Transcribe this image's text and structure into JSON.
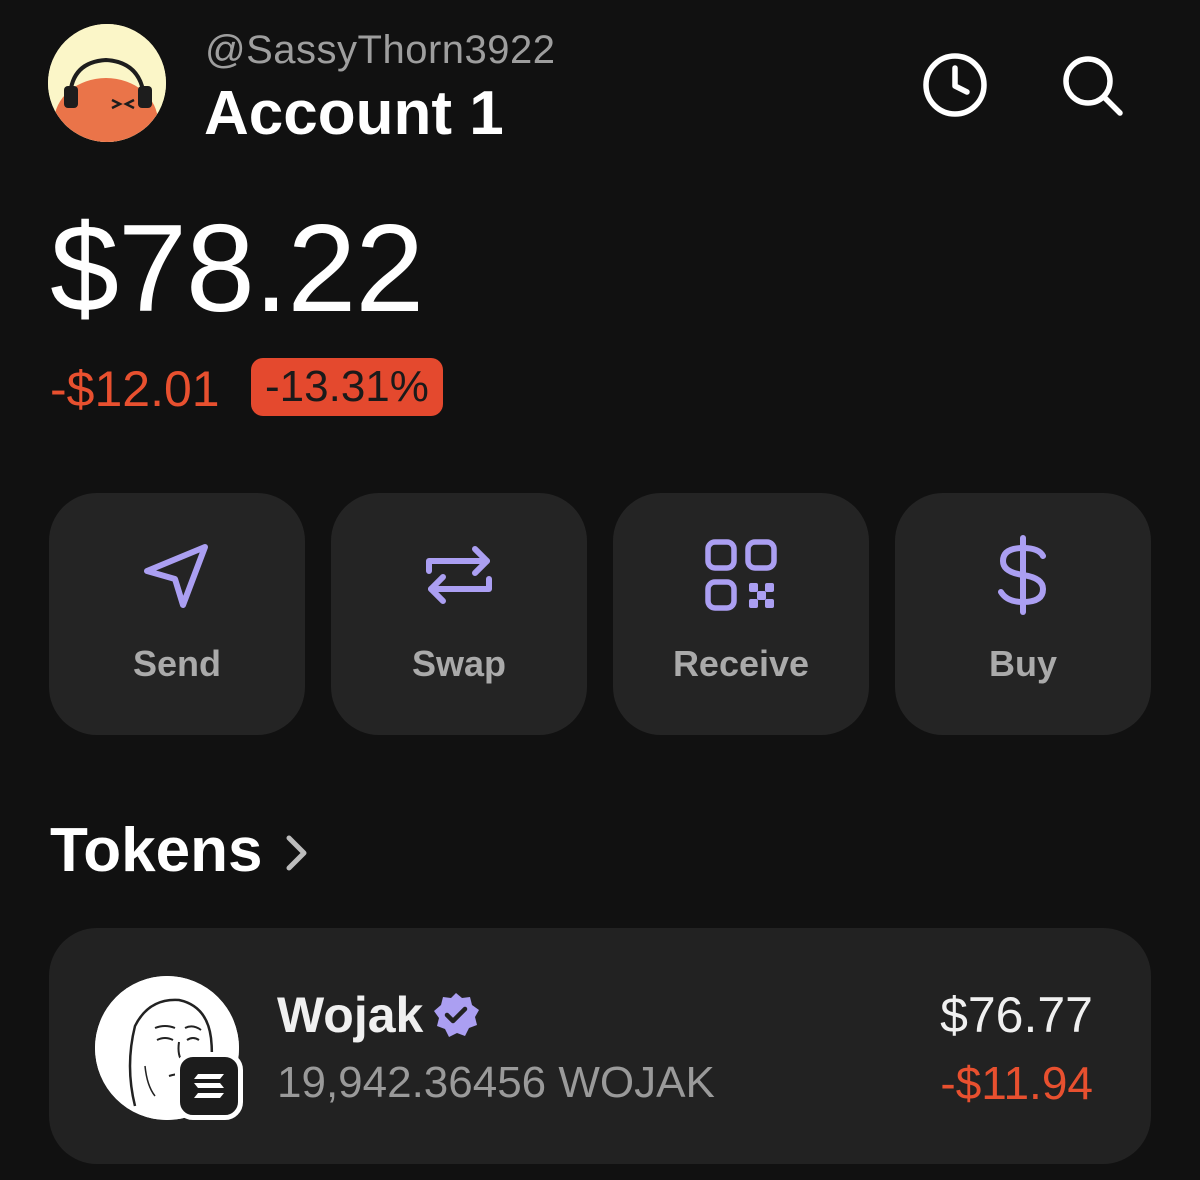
{
  "header": {
    "handle": "@SassyThorn3922",
    "account_name": "Account 1",
    "icons": [
      "avatar",
      "history-icon",
      "search-icon"
    ]
  },
  "balance": {
    "total": "$78.22",
    "change_amount": "-$12.01",
    "change_percent": "-13.31%"
  },
  "actions": [
    {
      "label": "Send",
      "icon": "send-icon"
    },
    {
      "label": "Swap",
      "icon": "swap-icon"
    },
    {
      "label": "Receive",
      "icon": "qr-code-icon"
    },
    {
      "label": "Buy",
      "icon": "dollar-icon"
    }
  ],
  "tokens": {
    "header": "Tokens",
    "items": [
      {
        "name": "Wojak",
        "verified": true,
        "amount": "19,942.36456 WOJAK",
        "value": "$76.77",
        "change": "-$11.94",
        "chain_icon": "solana-icon"
      }
    ]
  },
  "colors": {
    "background": "#111111",
    "card": "#242424",
    "accent": "#ab9ff2",
    "negative": "#e8502f"
  }
}
